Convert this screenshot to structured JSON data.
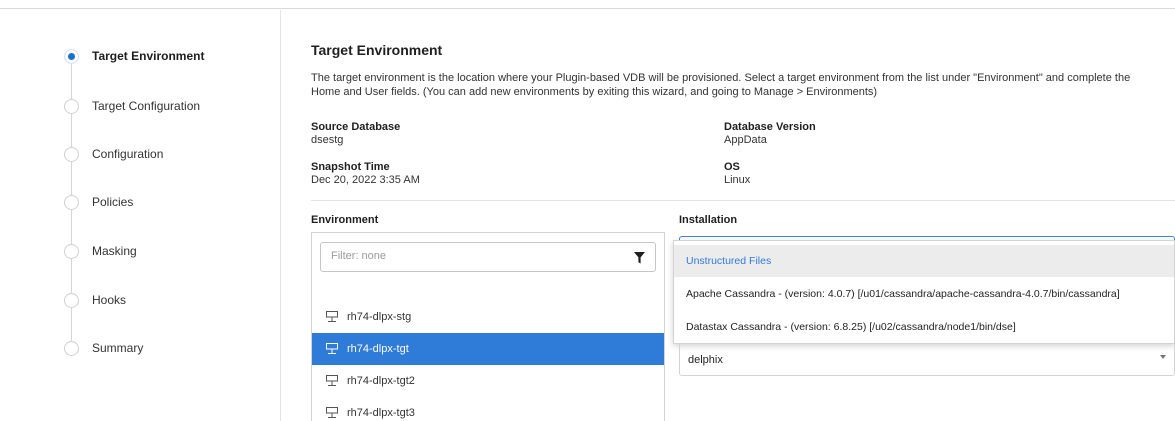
{
  "wizard": {
    "steps": [
      {
        "label": "Target Environment",
        "active": true
      },
      {
        "label": "Target Configuration",
        "active": false
      },
      {
        "label": "Configuration",
        "active": false
      },
      {
        "label": "Policies",
        "active": false
      },
      {
        "label": "Masking",
        "active": false
      },
      {
        "label": "Hooks",
        "active": false
      },
      {
        "label": "Summary",
        "active": false
      }
    ]
  },
  "main": {
    "title": "Target Environment",
    "description": "The target environment is the location where your Plugin-based VDB will be provisioned. Select a target environment from the list under \"Environment\" and complete the Home and User fields. (You can add new environments by exiting this wizard, and going to Manage > Environments)",
    "info": {
      "source_database_label": "Source Database",
      "source_database_value": "dsestg",
      "database_version_label": "Database Version",
      "database_version_value": "AppData",
      "snapshot_time_label": "Snapshot Time",
      "snapshot_time_value": "Dec 20, 2022 3:35 AM",
      "os_label": "OS",
      "os_value": "Linux"
    },
    "environment": {
      "heading": "Environment",
      "filter_placeholder": "Filter: none",
      "filter_icon": "funnel-icon",
      "items": [
        {
          "name": "rh74-dlpx-stg",
          "selected": false
        },
        {
          "name": "rh74-dlpx-tgt",
          "selected": true
        },
        {
          "name": "rh74-dlpx-tgt2",
          "selected": false
        },
        {
          "name": "rh74-dlpx-tgt3",
          "selected": false
        }
      ]
    },
    "installation": {
      "heading": "Installation",
      "options": [
        "Unstructured Files",
        "Apache Cassandra - (version: 4.0.7) [/u01/cassandra/apache-cassandra-4.0.7/bin/cassandra]",
        "Datastax Cassandra - (version: 6.8.25) [/u02/cassandra/node1/bin/dse]"
      ],
      "highlighted_option": "Unstructured Files",
      "user_value": "delphix"
    }
  },
  "colors": {
    "accent": "#2f7bd8",
    "active_dot": "#1a6fd1"
  }
}
